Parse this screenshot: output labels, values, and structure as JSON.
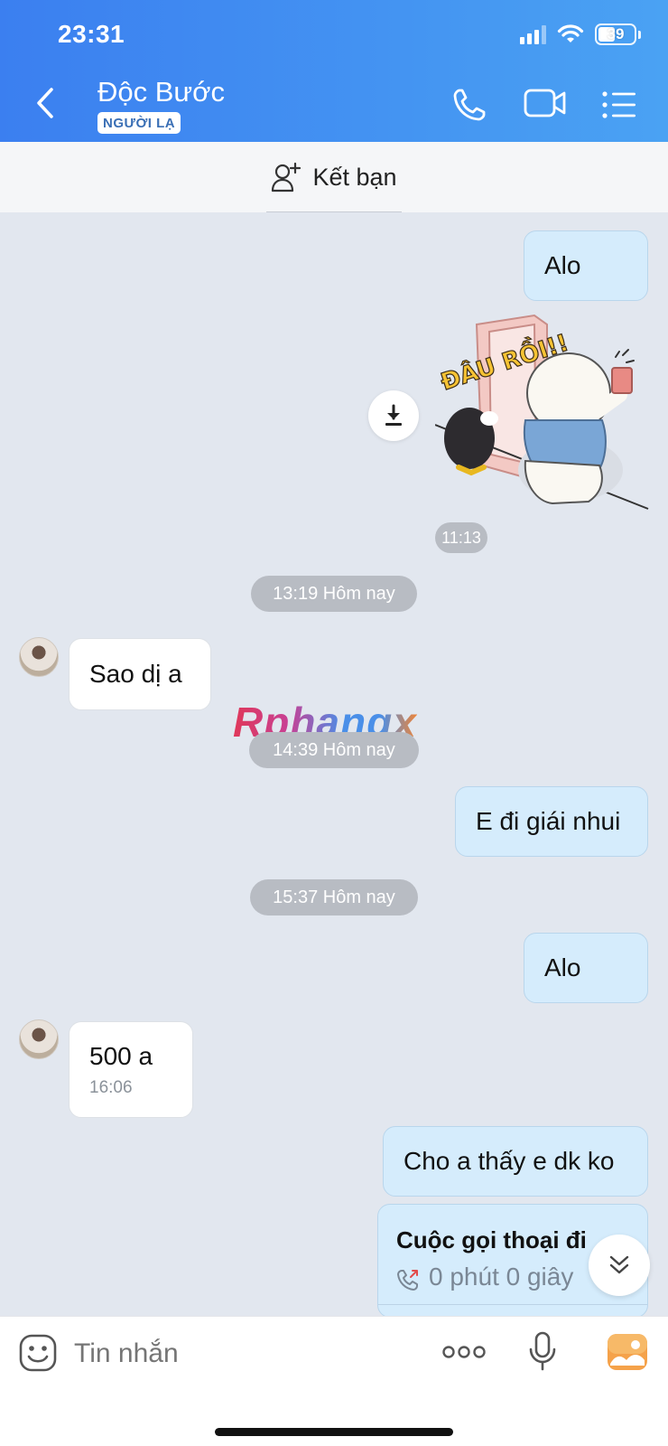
{
  "status_bar": {
    "time": "23:31",
    "battery": "39"
  },
  "header": {
    "contact_name": "Độc Bước",
    "badge": "NGƯỜI LẠ",
    "icons": [
      "chevron-left-icon",
      "phone-icon",
      "video-camera-icon",
      "menu-list-icon"
    ]
  },
  "add_friend": {
    "label": "Kết bạn",
    "icon": "add-person-icon"
  },
  "messages": [
    {
      "side": "me",
      "text": "Alo"
    },
    {
      "side": "me",
      "type": "sticker",
      "sticker_text": "ĐÂU RỒI!!",
      "time": "11:13"
    },
    {
      "type": "separator",
      "text": "13:19 Hôm nay"
    },
    {
      "side": "them",
      "text": "Sao dị a"
    },
    {
      "type": "separator",
      "text": "14:39 Hôm nay"
    },
    {
      "side": "me",
      "text": "E đi giái nhui"
    },
    {
      "type": "separator",
      "text": "15:37 Hôm nay"
    },
    {
      "side": "me",
      "text": "Alo"
    },
    {
      "side": "them",
      "text": "500 a",
      "time": "16:06"
    },
    {
      "side": "me",
      "text": "Cho a thấy e dk ko"
    },
    {
      "side": "me",
      "type": "call",
      "title": "Cuộc gọi thoại đi",
      "duration": "0 phút 0 giây"
    }
  ],
  "watermark": "Rphangx",
  "input_bar": {
    "placeholder": "Tin nhắn"
  },
  "colors": {
    "header_start": "#3b7ff0",
    "header_end": "#4aa2f3",
    "my_bubble": "#d5ecfc",
    "their_bubble": "#ffffff",
    "chat_bg": "#e2e7ef"
  }
}
